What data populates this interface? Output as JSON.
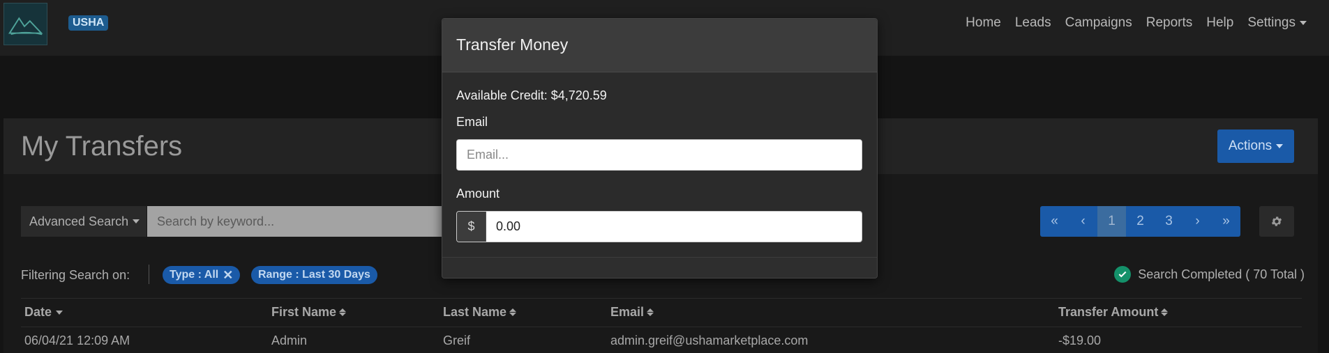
{
  "navbar": {
    "brand_badge": "USHA",
    "links": {
      "home": "Home",
      "leads": "Leads",
      "campaigns": "Campaigns",
      "reports": "Reports",
      "help": "Help",
      "settings": "Settings"
    }
  },
  "page": {
    "title": "My Transfers",
    "actions_label": "Actions"
  },
  "search": {
    "advanced_label": "Advanced Search",
    "placeholder": "Search by keyword..."
  },
  "pagination": {
    "first": "«",
    "prev": "‹",
    "pages": [
      "1",
      "2",
      "3"
    ],
    "active_page": "1",
    "next": "›",
    "last": "»"
  },
  "filters": {
    "label": "Filtering Search on:",
    "chips": [
      "Type : All",
      "Range : Last 30 Days"
    ]
  },
  "status": {
    "text": "Search Completed ( 70 Total )",
    "color": "#14916a"
  },
  "table": {
    "columns": [
      "Date",
      "First Name",
      "Last Name",
      "Email",
      "Transfer Amount"
    ],
    "rows": [
      [
        "06/04/21 12:09 AM",
        "Admin",
        "Greif",
        "admin.greif@ushamarketplace.com",
        "-$19.00"
      ]
    ]
  },
  "modal": {
    "title": "Transfer Money",
    "credit_text": "Available Credit: $4,720.59",
    "email_label": "Email",
    "email_placeholder": "Email...",
    "amount_label": "Amount",
    "amount_prefix": "$",
    "amount_value": "0.00"
  },
  "colors": {
    "accent": "#1a5aa8",
    "background": "#141414"
  }
}
